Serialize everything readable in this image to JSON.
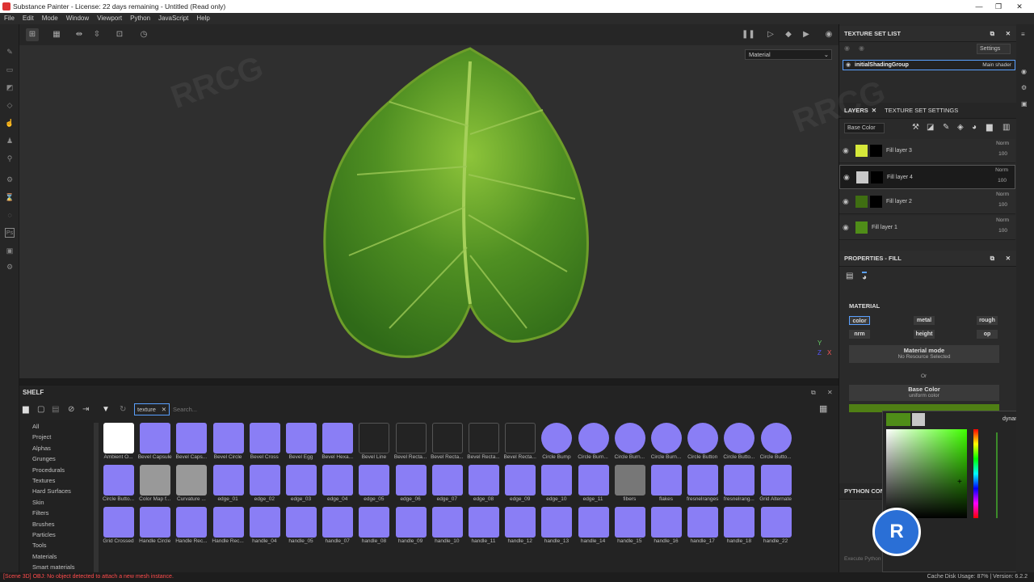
{
  "titlebar": {
    "title": "Substance Painter - License: 22 days remaining - Untitled (Read only)",
    "min": "—",
    "max": "❐",
    "close": "✕"
  },
  "menu": [
    "File",
    "Edit",
    "Mode",
    "Window",
    "Viewport",
    "Python",
    "JavaScript",
    "Help"
  ],
  "viewport": {
    "material_select": "Material",
    "axis_label": "Y",
    "axis_z": "Z",
    "axis_x": "X"
  },
  "texture_set_list": {
    "title": "TEXTURE SET LIST",
    "settings": "Settings",
    "group": "initialShadingGroup",
    "shader": "Main shader"
  },
  "layers_panel": {
    "tab_layers": "LAYERS",
    "tab_tss": "TEXTURE SET SETTINGS",
    "channel": "Base Color",
    "layers": [
      {
        "name": "Fill layer 3",
        "blend": "Norm",
        "opacity": "100",
        "color": "#d6e83a",
        "mask": "#000000"
      },
      {
        "name": "Fill layer 4",
        "blend": "Norm",
        "opacity": "100",
        "color": "#c9c9c9",
        "mask": "#000000"
      },
      {
        "name": "Fill layer 2",
        "blend": "Norm",
        "opacity": "100",
        "color": "#3f6e12",
        "mask": "#000000"
      },
      {
        "name": "Fill layer 1",
        "blend": "Norm",
        "opacity": "100",
        "color": "#4f8d18",
        "mask": ""
      }
    ]
  },
  "properties": {
    "title": "PROPERTIES - FILL",
    "section": "MATERIAL",
    "channels": [
      "color",
      "metal",
      "rough",
      "nrm",
      "height",
      "op"
    ],
    "material_mode": "Material mode",
    "no_resource": "No Resource Selected",
    "or": "Or",
    "base_color": "Base Color",
    "uniform": "uniform color",
    "base_color_value": "#4f7f14",
    "dynamic": "dynamic"
  },
  "python_console": {
    "title": "PYTHON CONSOLE",
    "placeholder": "Execute Python"
  },
  "shelf": {
    "title": "SHELF",
    "filter_tag": "texture",
    "search_placeholder": "Search...",
    "categories": [
      "All",
      "Project",
      "Alphas",
      "Grunges",
      "Procedurals",
      "Textures",
      "Hard Surfaces",
      "Skin",
      "Filters",
      "Brushes",
      "Particles",
      "Tools",
      "Materials",
      "Smart materials"
    ],
    "rows": [
      [
        "Ambient O...",
        "Bevel Capsule",
        "Bevel Caps...",
        "Bevel Circle",
        "Bevel Cross",
        "Bevel Egg",
        "Bevel Hexa...",
        "Bevel Line",
        "Bevel Recta...",
        "Bevel Recta...",
        "Bevel Recta...",
        "Bevel Recta...",
        "Circle Bump",
        "Circle Burn...",
        "Circle Burn...",
        "Circle Burn...",
        "Circle Button",
        "Circle Butto...",
        "Circle Butto..."
      ],
      [
        "Circle Butto...",
        "Color Map f...",
        "Curvature ...",
        "edge_01",
        "edge_02",
        "edge_03",
        "edge_04",
        "edge_05",
        "edge_06",
        "edge_07",
        "edge_08",
        "edge_09",
        "edge_10",
        "edge_11",
        "fibers",
        "flakes",
        "fresnelranges",
        "fresnelrang...",
        "Grid Alternate"
      ],
      [
        "Grid Crossed",
        "Handle Circle",
        "Handle Rec...",
        "Handle Rec...",
        "handle_04",
        "handle_05",
        "handle_07",
        "handle_08",
        "handle_09",
        "handle_10",
        "handle_11",
        "handle_12",
        "handle_13",
        "handle_14",
        "handle_15",
        "handle_16",
        "handle_17",
        "handle_18",
        "handle_22"
      ]
    ]
  },
  "status": {
    "left": "[Scene 3D] OBJ: No object detected to attach a new mesh instance.",
    "right": "Cache Disk Usage:  87% | Version: 6.2.2"
  },
  "watermark": "RRCG"
}
